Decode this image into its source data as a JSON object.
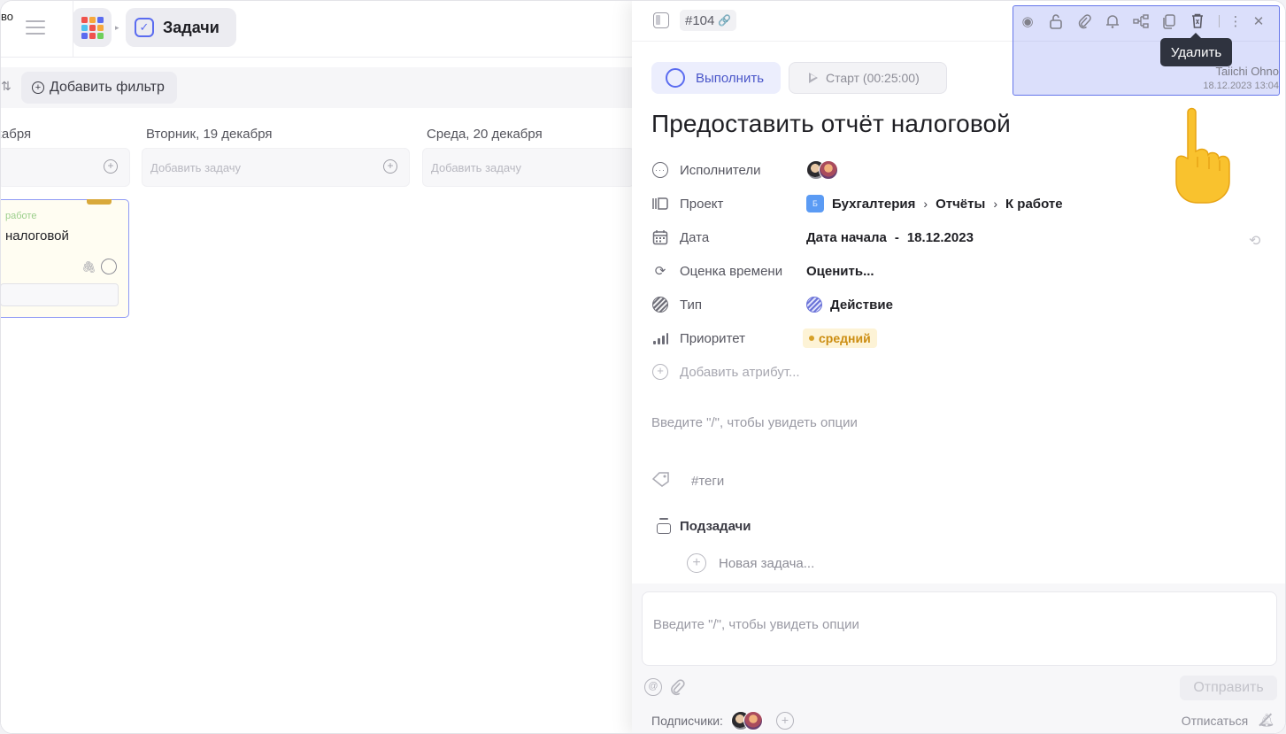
{
  "window": {
    "cut_left_text": "во"
  },
  "header": {
    "app_title": "Задачи",
    "apps_colors": [
      "#f0534d",
      "#f7a83b",
      "#5b6cf0",
      "#4fc2f0",
      "#f0534d",
      "#f7a83b",
      "#5b6cf0",
      "#f0534d",
      "#6fcf5c"
    ]
  },
  "filters": {
    "add_filter_label": "Добавить фильтр"
  },
  "board": {
    "columns": [
      {
        "head": "кабря",
        "add_placeholder": ""
      },
      {
        "head": "Вторник, 19 декабря",
        "add_placeholder": "Добавить задачу"
      },
      {
        "head": "Среда, 20 декабря",
        "add_placeholder": "Добавить задачу"
      }
    ],
    "card": {
      "status": "работе",
      "title": "налоговой"
    }
  },
  "panel": {
    "task_id": "#104",
    "toolbar_icons": [
      "eye-icon",
      "lock-icon",
      "paperclip-icon",
      "bell-icon",
      "hierarchy-icon",
      "copy-icon",
      "trash-icon",
      "more-icon",
      "close-icon"
    ],
    "tooltip": "Удалить",
    "owner": "Taiichi Ohno",
    "created": "18.12.2023 13:04",
    "complete_label": "Выполнить",
    "start_label": "Старт (00:25:00)",
    "title": "Предоставить отчёт налоговой",
    "attributes": {
      "assignees_label": "Исполнители",
      "project_label": "Проект",
      "project_badge": "Б",
      "project_path": [
        "Бухгалтерия",
        "Отчёты",
        "К работе"
      ],
      "date_label": "Дата",
      "date_value_label": "Дата начала",
      "date_value": "18.12.2023",
      "estimate_label": "Оценка времени",
      "estimate_value": "Оценить...",
      "type_label": "Тип",
      "type_value": "Действие",
      "priority_label": "Приоритет",
      "priority_value": "средний",
      "add_attribute": "Добавить атрибут..."
    },
    "editor_hint": "Введите \"/\", чтобы увидеть опции",
    "tags_label": "#теги",
    "subtasks_label": "Подзадачи",
    "new_task_label": "Новая задача...",
    "comment_placeholder": "Введите \"/\", чтобы увидеть опции",
    "send_label": "Отправить",
    "subscribers_label": "Подписчики:",
    "unsubscribe_label": "Отписаться"
  }
}
